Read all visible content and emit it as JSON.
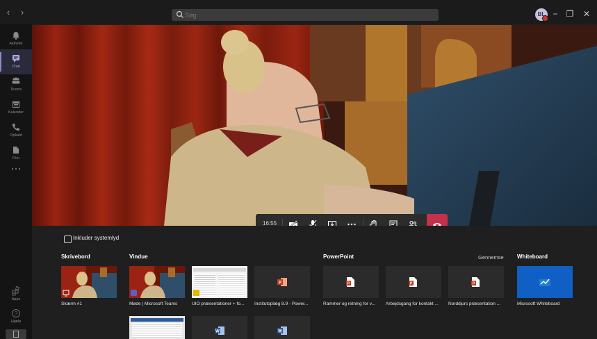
{
  "search": {
    "placeholder": "Søg"
  },
  "user": {
    "initials": "BL"
  },
  "rail": [
    {
      "label": "Aktivitet",
      "icon": "bell-icon"
    },
    {
      "label": "Chat",
      "icon": "chat-icon"
    },
    {
      "label": "Teams",
      "icon": "teams-icon"
    },
    {
      "label": "Kalender",
      "icon": "calendar-icon"
    },
    {
      "label": "Opkald",
      "icon": "phone-icon"
    },
    {
      "label": "Filer",
      "icon": "files-icon"
    },
    {
      "label": "Apps",
      "icon": "apps-icon"
    },
    {
      "label": "Hjælp",
      "icon": "help-icon"
    }
  ],
  "call": {
    "timer": "16:55"
  },
  "share": {
    "system_audio_label": "Inkluder systemlyd",
    "sections": {
      "desktop": "Skrivebord",
      "window": "Vindue",
      "powerpoint": "PowerPoint",
      "browse": "Gennemse",
      "whiteboard": "Whiteboard"
    },
    "tiles": {
      "screen1": "Skærm #1",
      "meeting": "Møde | Microsoft Teams",
      "uio": "UIO præsentationer + fo...",
      "institut": "Institutoplæg 8.9 - Power...",
      "ppt1": "Rammer og retning for v...",
      "ppt2": "Arbejdsgang for kontakt ...",
      "ppt3": "Norddjurs præsentation ...",
      "whiteboard": "Microsoft Whiteboard"
    }
  },
  "colors": {
    "accent": "#8b8cc7",
    "hangup": "#c4314b",
    "ppt": "#c43e1c",
    "word": "#2b579a",
    "whiteboard": "#0f5fc4"
  }
}
